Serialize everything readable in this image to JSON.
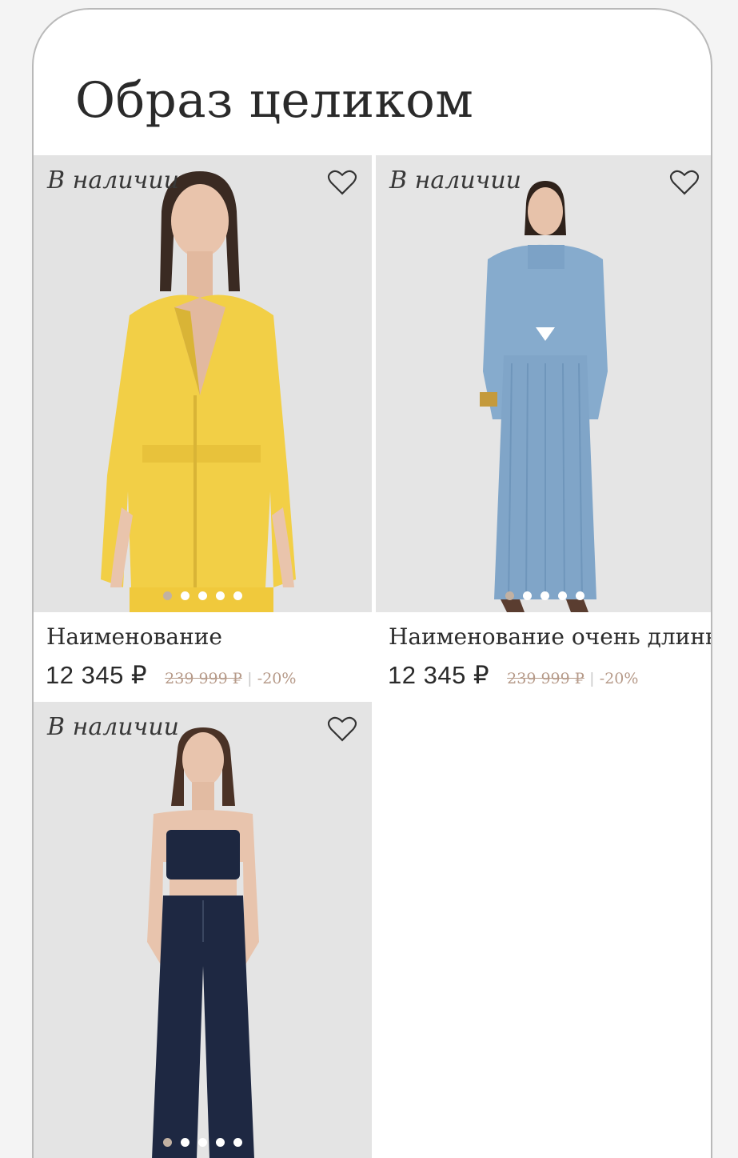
{
  "page": {
    "title": "Образ целиком"
  },
  "colors": {
    "accent_discount": "#b69a89",
    "dot_active": "#c2b1a2",
    "text": "#2a2a2a"
  },
  "products": [
    {
      "badge": "В наличии",
      "favorite_icon": "heart-icon",
      "name": "Наименование",
      "price": "12 345 ₽",
      "old_price": "239 999 ₽",
      "separator": "|",
      "discount": "-20%",
      "image_count": 5,
      "active_image": 1,
      "outfit_color": "#f2cf46"
    },
    {
      "badge": "В наличии",
      "favorite_icon": "heart-icon",
      "name": "Наименование очень длинное",
      "price": "12 345 ₽",
      "old_price": "239 999 ₽",
      "separator": "|",
      "discount": "-20%",
      "image_count": 5,
      "active_image": 1,
      "outfit_color": "#86abcd"
    },
    {
      "badge": "В наличии",
      "favorite_icon": "heart-icon",
      "image_count": 5,
      "active_image": 1,
      "outfit_color": "#1d2740"
    }
  ]
}
